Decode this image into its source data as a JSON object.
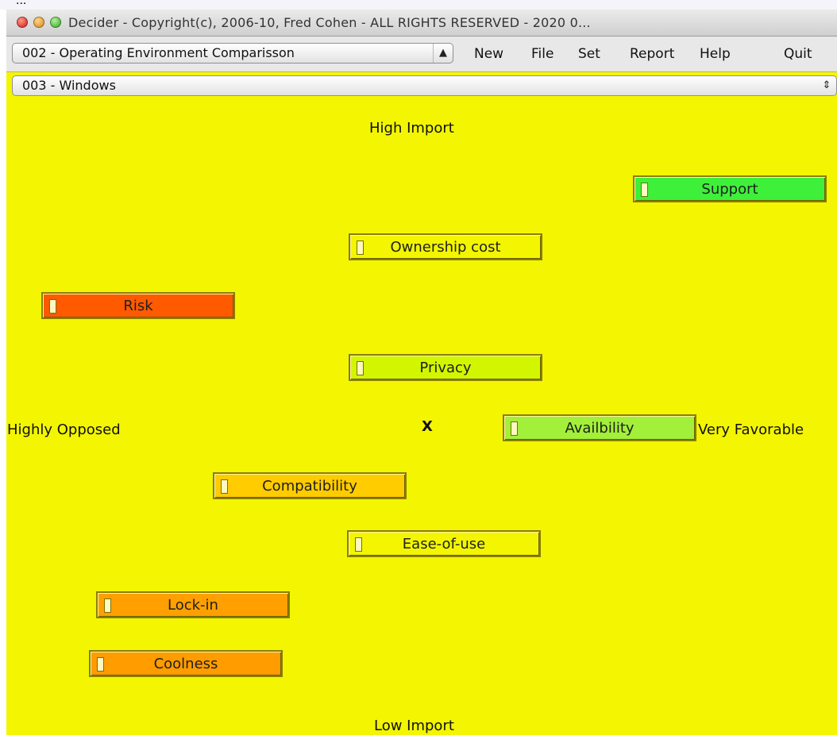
{
  "window": {
    "title": "Decider - Copyright(c), 2006-10, Fred Cohen - ALL RIGHTS RESERVED - 2020 0..."
  },
  "toolbar": {
    "project_select": "002 - Operating Environment Comparisson",
    "menu": [
      "New",
      "File",
      "Set",
      "Report",
      "Help"
    ],
    "quit_label": "Quit"
  },
  "option_select": "003 - Windows",
  "axes": {
    "top": "High Import",
    "bottom": "Low Import",
    "left": "Highly Opposed",
    "right": "Very Favorable"
  },
  "center_marker": "X",
  "factors": [
    {
      "label": "Support",
      "color": "#3ef03a"
    },
    {
      "label": "Ownership cost",
      "color": "#f3f600"
    },
    {
      "label": "Risk",
      "color": "#ff5a00"
    },
    {
      "label": "Privacy",
      "color": "#d2f600"
    },
    {
      "label": "Availbility",
      "color": "#a2f03a"
    },
    {
      "label": "Compatibility",
      "color": "#ffcc00"
    },
    {
      "label": "Ease-of-use",
      "color": "#f3f600"
    },
    {
      "label": "Lock-in",
      "color": "#ffa000"
    },
    {
      "label": "Coolness",
      "color": "#ff9c00"
    }
  ]
}
